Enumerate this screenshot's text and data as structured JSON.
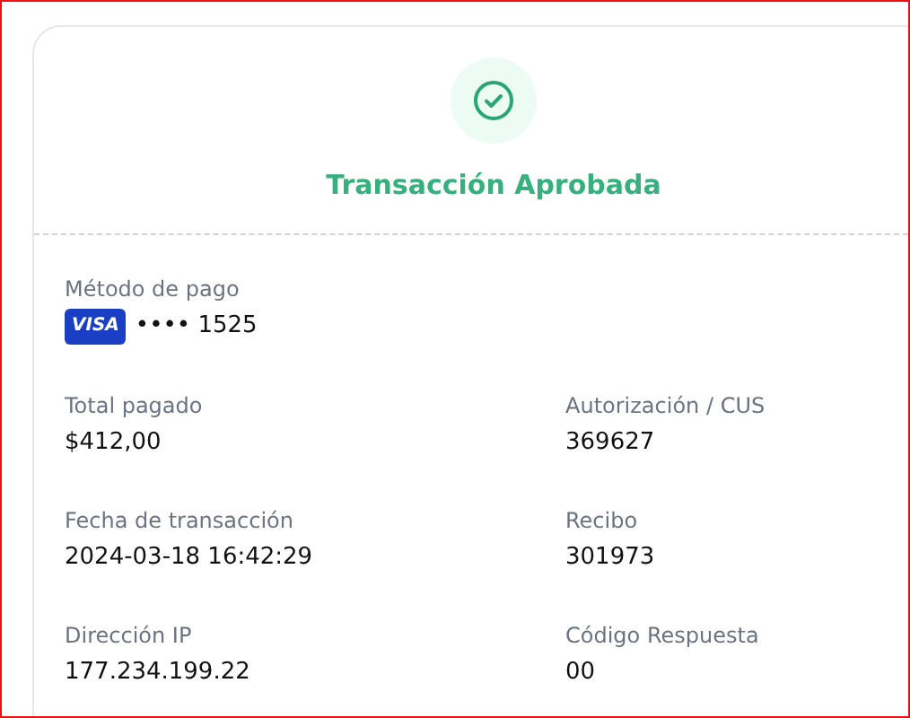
{
  "status": {
    "title": "Transacción Aprobada"
  },
  "payment_method": {
    "label": "Método de pago",
    "brand": "VISA",
    "masked_number": "•••• 1525"
  },
  "fields": [
    {
      "label": "Total pagado",
      "value": "$412,00"
    },
    {
      "label": "Autorización / CUS",
      "value": "369627"
    },
    {
      "label": "Fecha de transacción",
      "value": "2024-03-18 16:42:29"
    },
    {
      "label": "Recibo",
      "value": "301973"
    },
    {
      "label": "Dirección IP",
      "value": "177.234.199.22"
    },
    {
      "label": "Código Respuesta",
      "value": "00"
    }
  ]
}
